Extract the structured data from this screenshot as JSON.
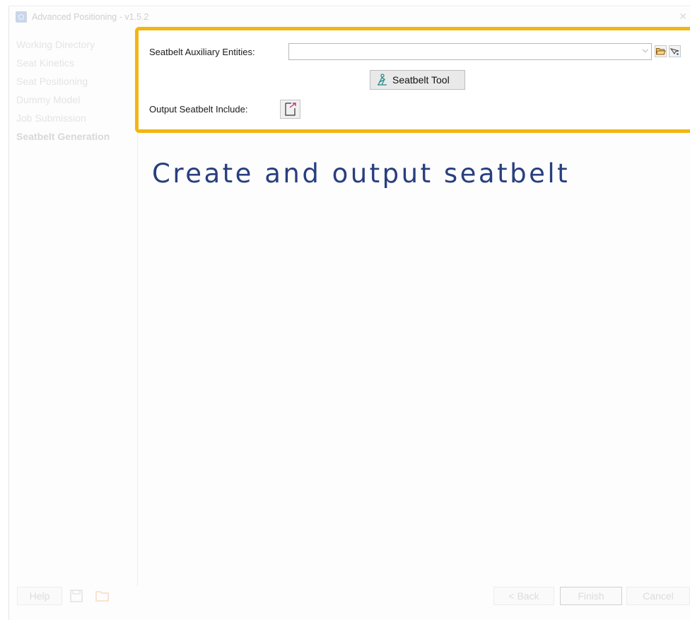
{
  "window": {
    "title": "Advanced Positioning - v1.5.2"
  },
  "sidebar": {
    "items": [
      {
        "label": "Working Directory"
      },
      {
        "label": "Seat Kinetics"
      },
      {
        "label": "Seat Positioning"
      },
      {
        "label": "Dummy Model"
      },
      {
        "label": "Job Submission"
      },
      {
        "label": "Seatbelt Generation"
      }
    ]
  },
  "form": {
    "aux_label": "Seatbelt Auxiliary Entities:",
    "aux_value": "",
    "tool_button": "Seatbelt Tool",
    "output_label": "Output Seatbelt Include:"
  },
  "caption": "Create and output seatbelt",
  "footer": {
    "help": "Help",
    "back": "< Back",
    "finish": "Finish",
    "cancel": "Cancel"
  },
  "colors": {
    "highlight": "#f3b60f",
    "caption": "#283f7e"
  }
}
